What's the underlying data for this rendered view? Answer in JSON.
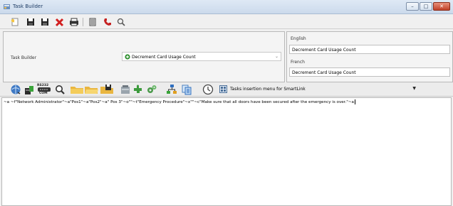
{
  "window": {
    "title": "Task Builder",
    "minimize_glyph": "–",
    "maximize_glyph": "□",
    "close_glyph": "✕"
  },
  "toolbar": {
    "icons": [
      "new-icon",
      "save-icon",
      "save-as-icon",
      "delete-icon",
      "print-icon",
      "list-icon",
      "phone-icon",
      "search-icon"
    ]
  },
  "form": {
    "task_builder_label": "Task Builder",
    "task_combo_value": "Decrement Card Usage Count",
    "english_label": "English",
    "english_value": "Decrement Card Usage Count",
    "french_label": "French",
    "french_value": "Decrement Card Usage Count"
  },
  "insertion_bar": {
    "rs232_label_top": "RS232",
    "rs232_label_bottom": "COM",
    "menu_label": "Tasks insertion menu for SmartLink",
    "menu_arrow": "▼"
  },
  "editor": {
    "content": "~a ~f\"Network Administrator\"~a\"Pos1\"~a\"Pos2\"~a\" Pos 3\"~o\"\"~t\"Emergency Procedure\"~x\"\"~c\"Make sure that all doors have been secured after the emergency is over.\"~a"
  },
  "colors": {
    "title_text": "#1e3c64",
    "close_button": "#c0412a",
    "accent_green": "#2f8f2f"
  }
}
